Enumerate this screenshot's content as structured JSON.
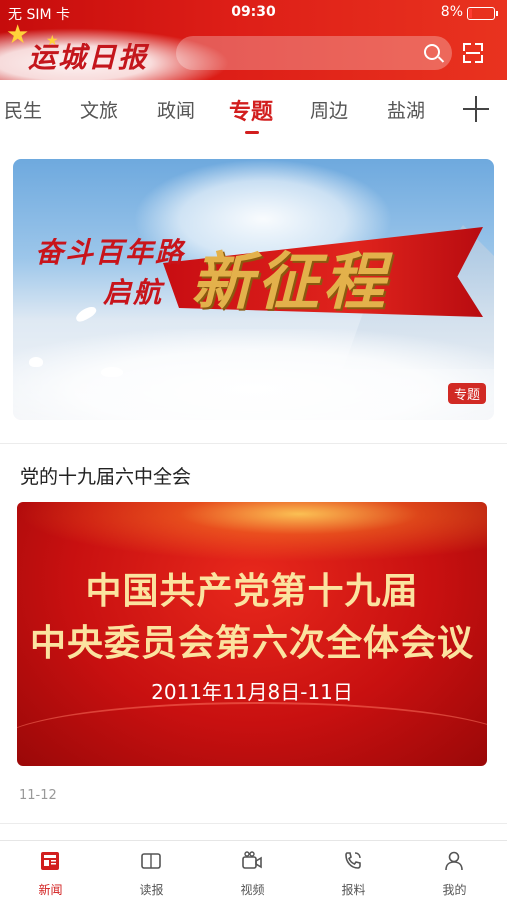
{
  "status_bar": {
    "carrier": "无 SIM 卡",
    "time": "09:30",
    "battery": "8%"
  },
  "header": {
    "logo": "运城日报",
    "search_placeholder": "",
    "icons": [
      "search-icon",
      "scan-icon"
    ]
  },
  "tabs": {
    "items": [
      {
        "label": "民生"
      },
      {
        "label": "文旅"
      },
      {
        "label": "政闻"
      },
      {
        "label": "专题",
        "active": true
      },
      {
        "label": "周边"
      },
      {
        "label": "盐湖"
      }
    ],
    "add_icon": "plus-icon"
  },
  "banner": {
    "line1": "奋斗百年路",
    "line2": "启航",
    "big_text": "新征程",
    "badge": "专题"
  },
  "article": {
    "title": "党的十九届六中全会",
    "image_line1": "中国共产党第十九届",
    "image_line2": "中央委员会第六次全体会议",
    "image_date": "2011年11月8日-11日",
    "date": "11-12"
  },
  "bottom_nav": {
    "items": [
      {
        "label": "新闻",
        "icon": "news-icon",
        "active": true
      },
      {
        "label": "读报",
        "icon": "newspaper-icon"
      },
      {
        "label": "视频",
        "icon": "video-icon"
      },
      {
        "label": "报料",
        "icon": "phone-icon"
      },
      {
        "label": "我的",
        "icon": "user-icon"
      }
    ]
  },
  "colors": {
    "brand_red": "#d21e1e",
    "header_red": "#dd1e17",
    "banner_gold": "#e3b14b"
  }
}
